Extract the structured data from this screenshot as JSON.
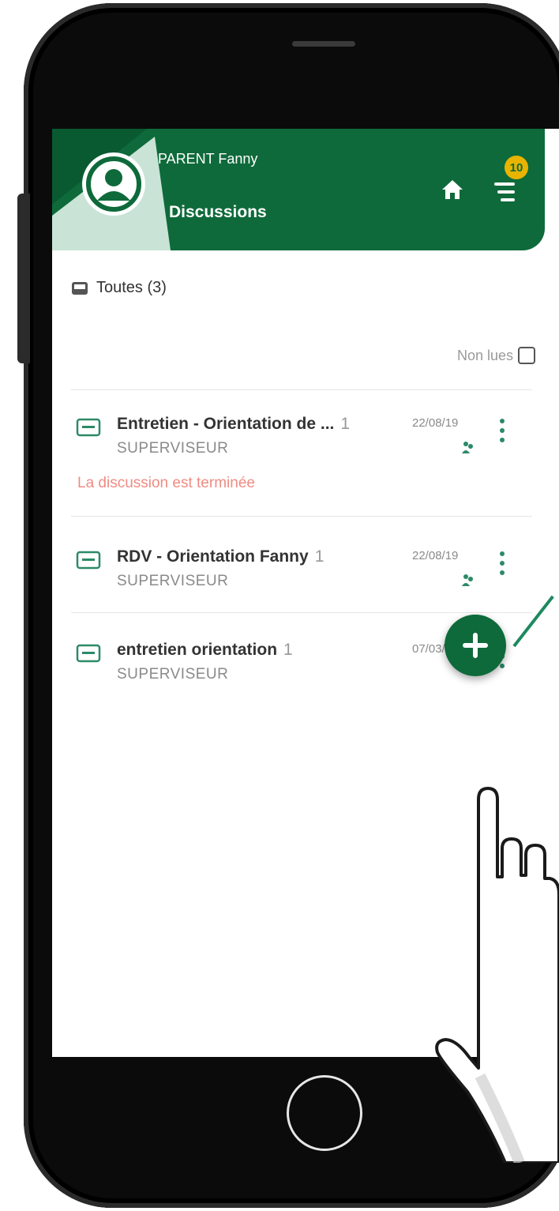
{
  "header": {
    "user_name": "PARENT Fanny",
    "page_title": "Discussions",
    "notification_count": "10",
    "colors": {
      "primary": "#0e6a3a",
      "badge": "#e8b400"
    },
    "icons": [
      "avatar-icon",
      "home-icon",
      "menu-icon"
    ]
  },
  "filter": {
    "label": "Toutes (3)",
    "unread_label": "Non lues",
    "unread_checked": false
  },
  "discussions": [
    {
      "title": "Entretien - Orientation de ...",
      "count": "1",
      "role": "SUPERVISEUR",
      "date": "22/08/19",
      "note": "La discussion est terminée",
      "has_status_icon": true
    },
    {
      "title": "RDV - Orientation Fanny",
      "count": "1",
      "role": "SUPERVISEUR",
      "date": "22/08/19",
      "note": "",
      "has_status_icon": true
    },
    {
      "title": "entretien orientation",
      "count": "1",
      "role": "SUPERVISEUR",
      "date": "07/03/19",
      "note": "",
      "has_status_icon": false
    }
  ],
  "fab": {
    "icon": "plus-icon"
  },
  "colors": {
    "note": "#f08b82",
    "text_muted": "#8a8a8a"
  }
}
